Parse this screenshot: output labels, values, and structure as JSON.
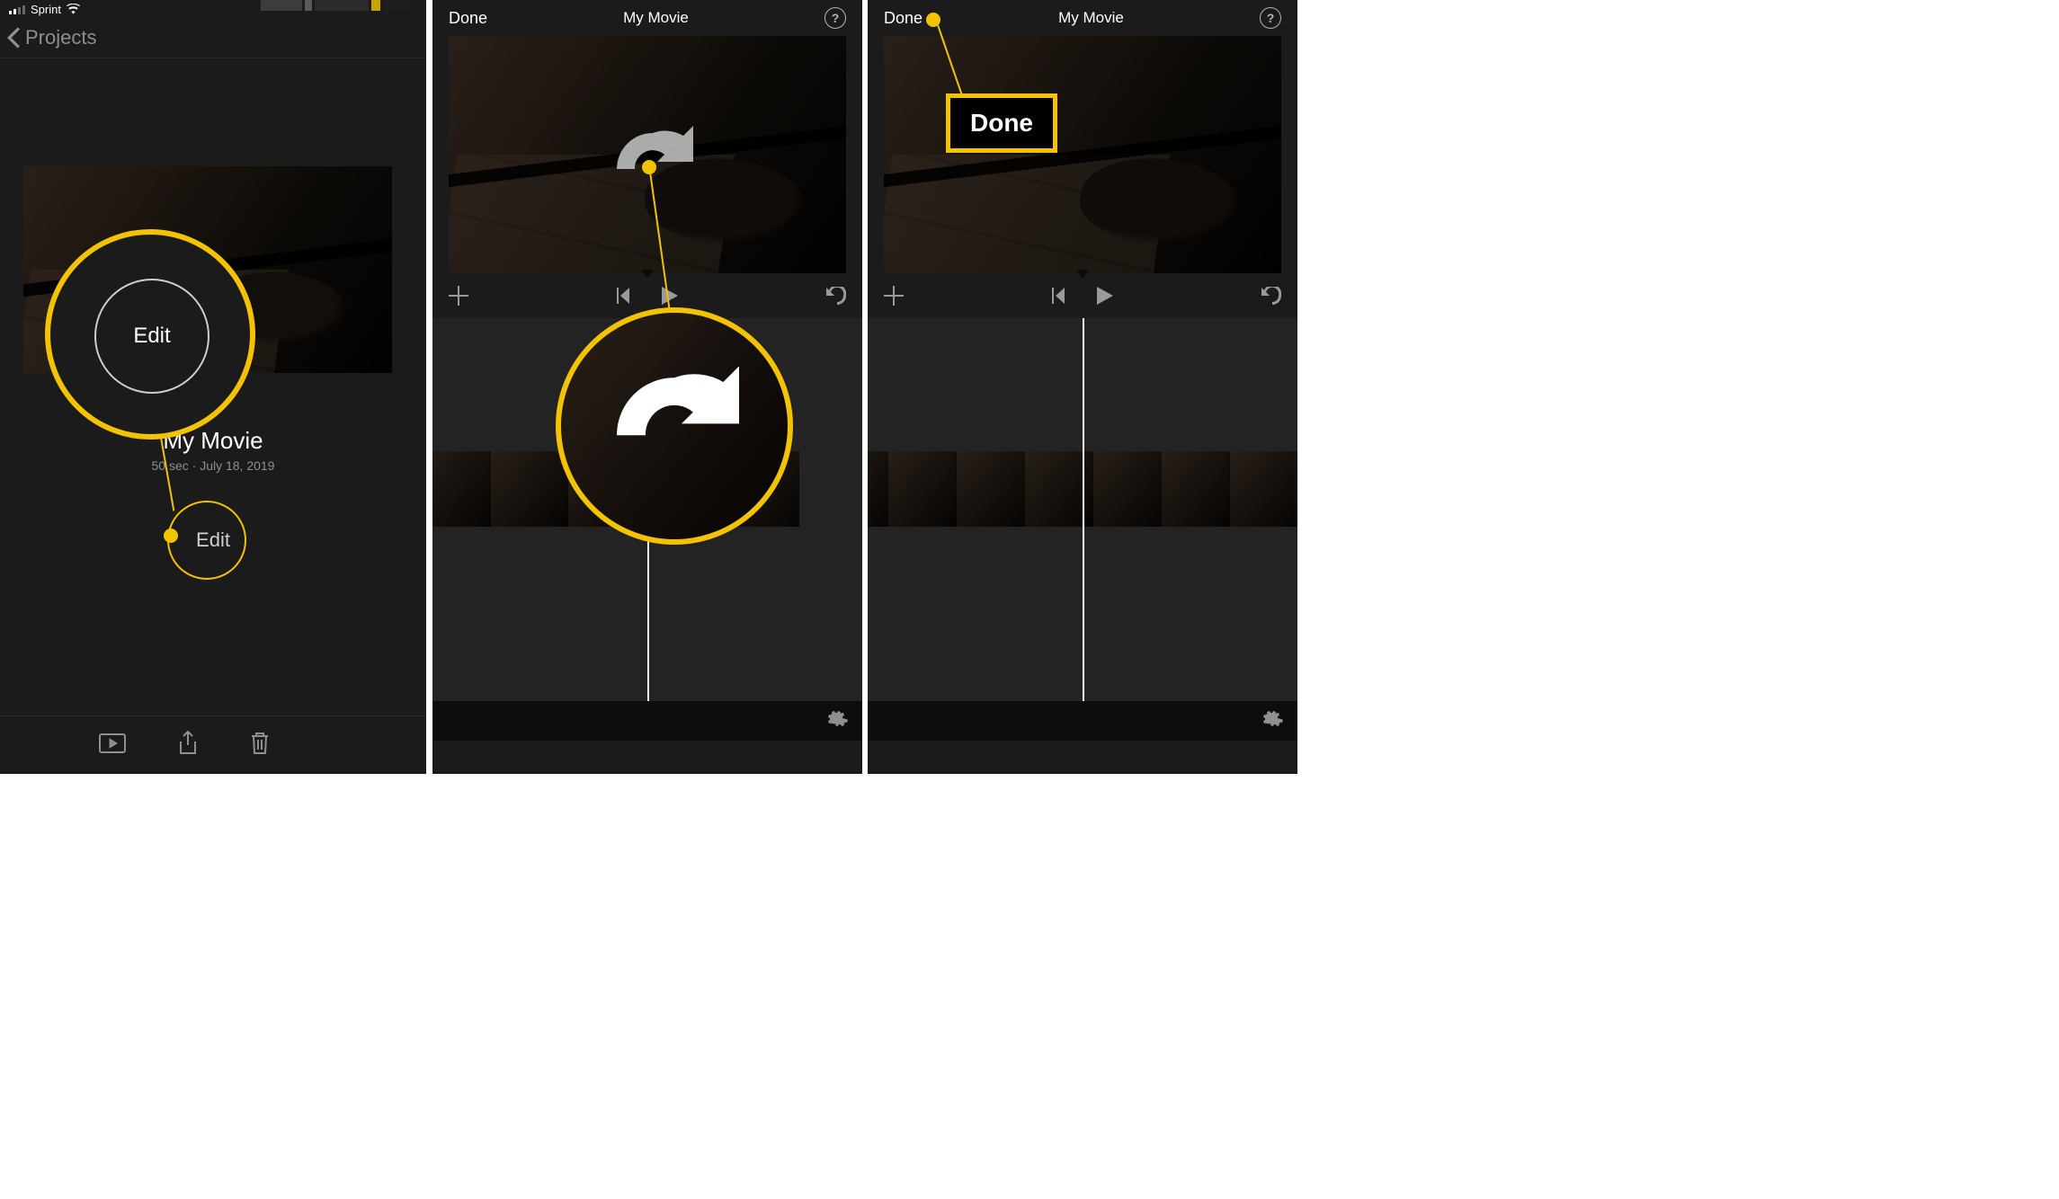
{
  "statusbar": {
    "carrier": "Sprint"
  },
  "panel1": {
    "back_label": "Projects",
    "project_title": "My Movie",
    "project_meta": "50 sec · July 18, 2019",
    "edit_label": "Edit",
    "edit_callout": "Edit"
  },
  "panel2": {
    "done_label": "Done",
    "title": "My Movie",
    "help_glyph": "?"
  },
  "panel3": {
    "done_label": "Done",
    "title": "My Movie",
    "help_glyph": "?",
    "callout_label": "Done"
  }
}
